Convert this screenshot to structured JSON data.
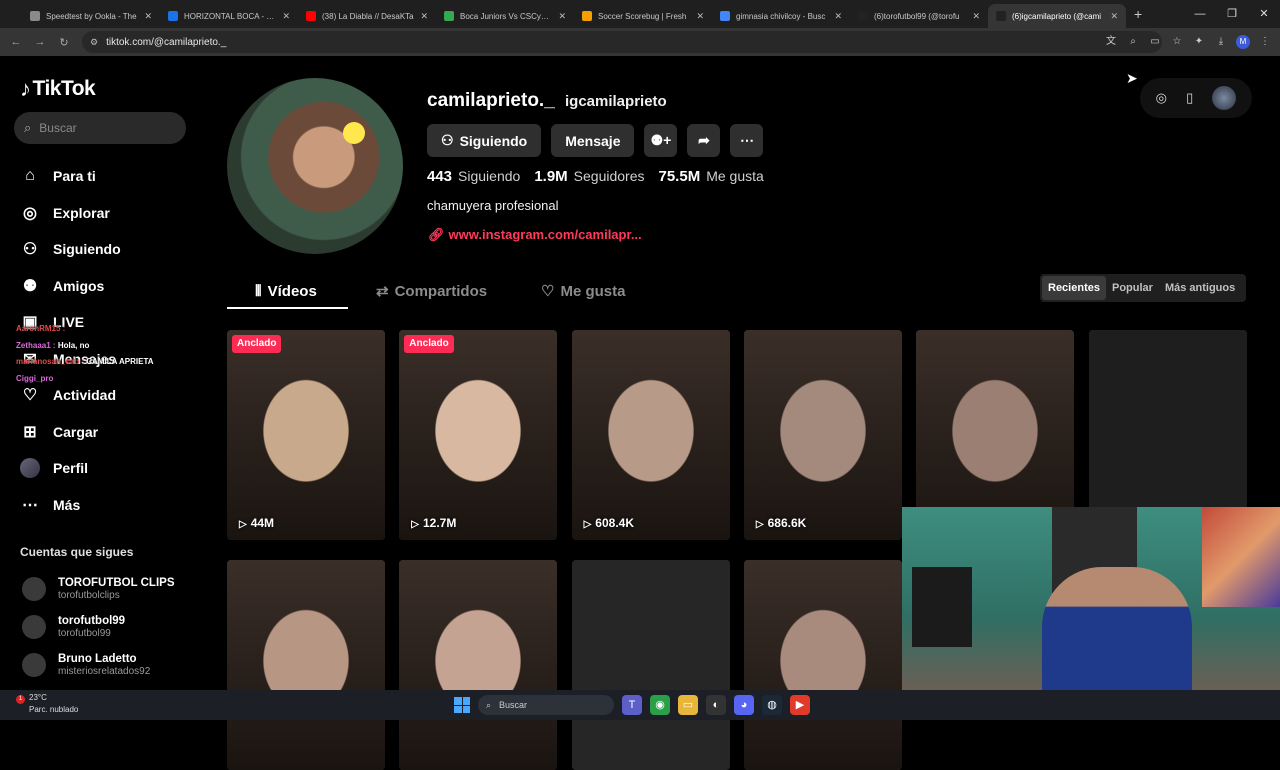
{
  "browser": {
    "tabs": [
      {
        "label": "Speedtest by Ookla - The",
        "color": "#8a8a8a",
        "active": false
      },
      {
        "label": "HORIZONTAL BOCA - Go",
        "color": "#1a73e8",
        "active": false
      },
      {
        "label": "(38) La Diabla // DesaKTa",
        "color": "#ff0000",
        "active": false
      },
      {
        "label": "Boca Juniors Vs CSCyD Gi",
        "color": "#34a853",
        "active": false
      },
      {
        "label": "Soccer Scorebug | Fresh",
        "color": "#f4a100",
        "active": false
      },
      {
        "label": "gimnasia chivilcoy - Busc",
        "color": "#4285f4",
        "active": false
      },
      {
        "label": "(6)torofutbol99 (@torofu",
        "color": "#222222",
        "active": false
      },
      {
        "label": "(6)igcamilaprieto (@cami",
        "color": "#222222",
        "active": true
      }
    ],
    "new_tab": "+",
    "url": "tiktok.com/@camilaprieto._"
  },
  "sidebar": {
    "logo": "TikTok",
    "search_placeholder": "Buscar",
    "nav": [
      {
        "label": "Para ti",
        "icon": "home-icon",
        "glyph": "⌂"
      },
      {
        "label": "Explorar",
        "icon": "compass-icon",
        "glyph": "◎"
      },
      {
        "label": "Siguiendo",
        "icon": "following-icon",
        "glyph": "⚇"
      },
      {
        "label": "Amigos",
        "icon": "friends-icon",
        "glyph": "⚉"
      },
      {
        "label": "LIVE",
        "icon": "live-icon",
        "glyph": "▣"
      },
      {
        "label": "Mensajes",
        "icon": "messages-icon",
        "glyph": "✉"
      },
      {
        "label": "Actividad",
        "icon": "activity-icon",
        "glyph": "♡"
      },
      {
        "label": "Cargar",
        "icon": "upload-icon",
        "glyph": "⊞"
      },
      {
        "label": "Perfil",
        "icon": "profile-icon",
        "glyph": ""
      },
      {
        "label": "Más",
        "icon": "more-icon",
        "glyph": "⋯"
      }
    ],
    "following_title": "Cuentas que sigues",
    "following": [
      {
        "name": "TOROFUTBOL CLIPS",
        "handle": "torofutbolclips"
      },
      {
        "name": "torofutbol99",
        "handle": "torofutbol99"
      },
      {
        "name": "Bruno Ladetto",
        "handle": "misteriosrelatados92"
      }
    ]
  },
  "chat": [
    {
      "user": "AaronRM15 :",
      "text": ""
    },
    {
      "user": "Zethaaa1 :",
      "text": "Hola, no"
    },
    {
      "user": "marianosan_cab :",
      "text": "CAMILA APRIETA"
    },
    {
      "user": "Ciggi_pro",
      "text": ""
    }
  ],
  "profile": {
    "username": "camilaprieto._",
    "nickname": "igcamilaprieto",
    "buttons": {
      "follow": "Siguiendo",
      "message": "Mensaje"
    },
    "stats": [
      {
        "num": "443",
        "label": "Siguiendo"
      },
      {
        "num": "1.9M",
        "label": "Seguidores"
      },
      {
        "num": "75.5M",
        "label": "Me gusta"
      }
    ],
    "bio": "chamuyera profesional",
    "link": "www.instagram.com/camilapr..."
  },
  "tabs": [
    {
      "label": "Vídeos",
      "glyph": "⦀"
    },
    {
      "label": "Compartidos",
      "glyph": "⇄"
    },
    {
      "label": "Me gusta",
      "glyph": "♡"
    }
  ],
  "sort": [
    "Recientes",
    "Popular",
    "Más antiguos"
  ],
  "videos": [
    {
      "pinned": "Anclado",
      "views": "44M",
      "tone": "#c9a98c"
    },
    {
      "pinned": "Anclado",
      "views": "12.7M",
      "tone": "#d8b8a0"
    },
    {
      "pinned": "",
      "views": "608.4K",
      "tone": "#b89a88"
    },
    {
      "pinned": "",
      "views": "686.6K",
      "tone": "#a38a7c"
    },
    {
      "pinned": "",
      "views": "",
      "tone": "#9a7f72"
    },
    {
      "pinned": "",
      "views": "",
      "tone": "#1e1e1e"
    },
    {
      "pinned": "",
      "views": "",
      "tone": "#b79684"
    },
    {
      "pinned": "",
      "views": "",
      "tone": "#c4a392"
    },
    {
      "pinned": "",
      "views": "",
      "tone": "#262626"
    },
    {
      "pinned": "",
      "views": "",
      "tone": "#a88b7d"
    }
  ],
  "taskbar": {
    "temperature": "23°C",
    "weather": "Parc. nublado",
    "badge": "1",
    "search": "Buscar"
  }
}
